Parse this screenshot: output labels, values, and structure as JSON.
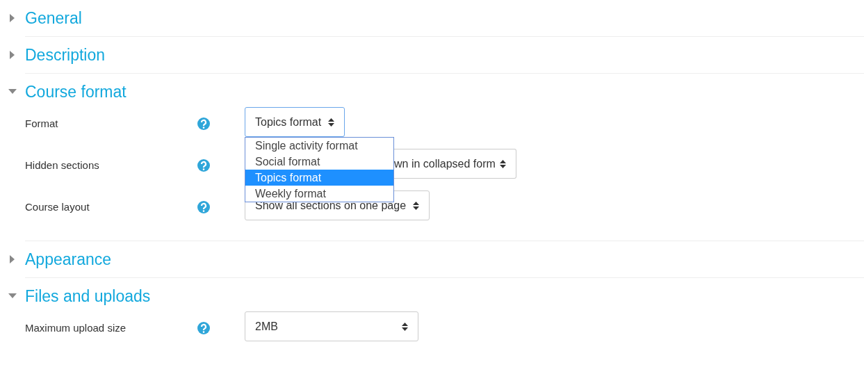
{
  "sections": [
    {
      "title": "General",
      "expanded": false
    },
    {
      "title": "Description",
      "expanded": false
    },
    {
      "title": "Course format",
      "expanded": true,
      "fields": [
        {
          "label": "Format",
          "kind": "select",
          "value": "Topics format",
          "open": true,
          "options": [
            {
              "label": "Single activity format",
              "selected": false
            },
            {
              "label": "Social format",
              "selected": false
            },
            {
              "label": "Topics format",
              "selected": true
            },
            {
              "label": "Weekly format",
              "selected": false
            }
          ]
        },
        {
          "label": "Hidden sections",
          "kind": "covered-select",
          "value": "wn in collapsed form"
        },
        {
          "label": "Course layout",
          "kind": "select",
          "value": "Show all sections on one page"
        }
      ]
    },
    {
      "title": "Appearance",
      "expanded": false
    },
    {
      "title": "Files and uploads",
      "expanded": true,
      "fields": [
        {
          "label": "Maximum upload size",
          "kind": "select",
          "value": "2MB",
          "wide": true
        }
      ]
    }
  ]
}
